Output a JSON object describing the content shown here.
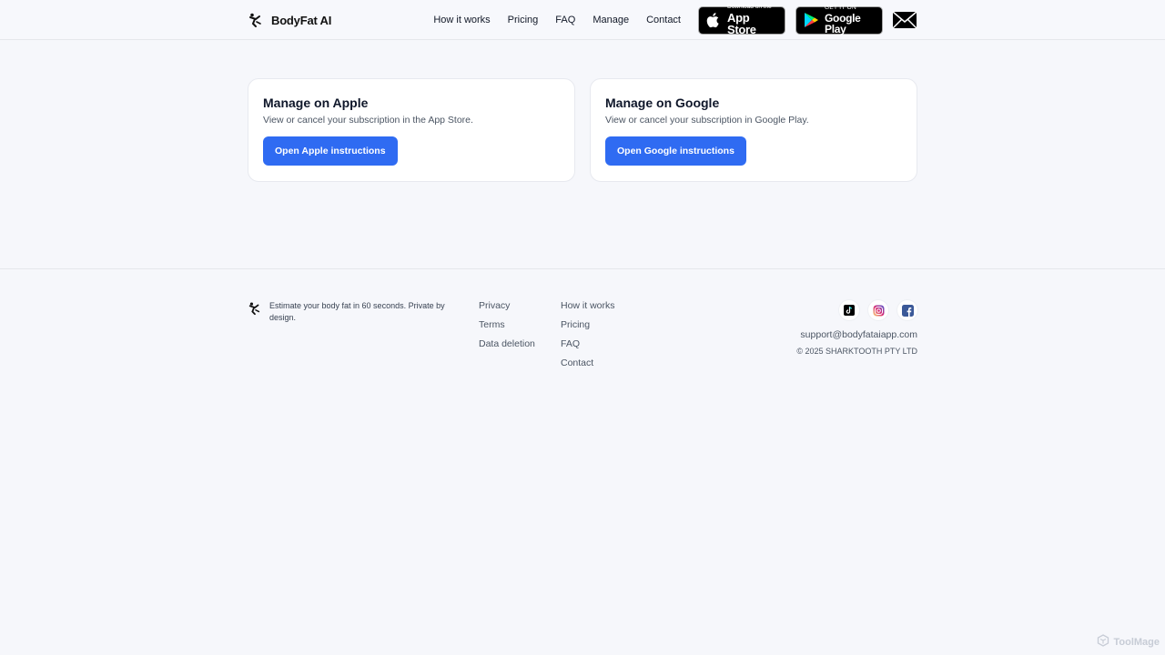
{
  "header": {
    "brand": "BodyFat AI",
    "nav": [
      "How it works",
      "Pricing",
      "FAQ",
      "Manage",
      "Contact"
    ],
    "app_store": {
      "small": "Download on the",
      "big": "App Store"
    },
    "google_play": {
      "small": "GET IT ON",
      "big": "Google Play"
    }
  },
  "cards": [
    {
      "title": "Manage on Apple",
      "desc": "View or cancel your subscription in the App Store.",
      "button": "Open Apple instructions"
    },
    {
      "title": "Manage on Google",
      "desc": "View or cancel your subscription in Google Play.",
      "button": "Open Google instructions"
    }
  ],
  "footer": {
    "tagline": "Estimate your body fat in 60 seconds. Private by design.",
    "col1": [
      "Privacy",
      "Terms",
      "Data deletion"
    ],
    "col2": [
      "How it works",
      "Pricing",
      "FAQ",
      "Contact"
    ],
    "socials": [
      "tiktok-icon",
      "instagram-icon",
      "facebook-icon"
    ],
    "email": "support@bodyfataiapp.com",
    "copyright": "© 2025 SHARKTOOTH PTY LTD"
  },
  "watermark": "ToolMage",
  "colors": {
    "accent": "#2f6bf2",
    "background": "#f6f7fb"
  }
}
